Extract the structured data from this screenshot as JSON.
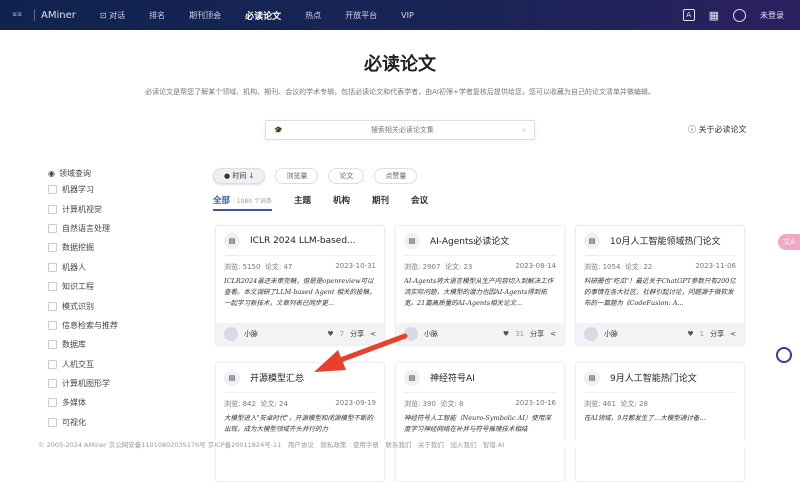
{
  "header": {
    "logo1": "AMiner logo",
    "logo2": "AMiner",
    "nav": [
      "对话",
      "排名",
      "期刊顶会",
      "必读论文",
      "热点",
      "开放平台",
      "VIP"
    ],
    "active": "必读论文",
    "login": "未登录"
  },
  "page": {
    "title": "必读论文",
    "description": "必读论文是帮您了解某个领域、机构、期刊、会议的学术专辑，包括必读论文和代表学者，由AI初筛+学者复核后提供给您，您可以收藏为自己的论文清单并做编辑。",
    "search_placeholder": "搜索相关必读论文集",
    "help": "关于必读论文"
  },
  "sidebar": {
    "heading": "领域查询",
    "items": [
      "机器学习",
      "计算机视觉",
      "自然语言处理",
      "数据挖掘",
      "机器人",
      "知识工程",
      "模式识别",
      "信息检索与推荐",
      "数据库",
      "人机交互",
      "计算机图形学",
      "多媒体",
      "可视化"
    ]
  },
  "sort": [
    "时间 ↓",
    "浏览量",
    "论文",
    "点赞量"
  ],
  "tabs": {
    "all": "全部",
    "count": "· 1080 个词条",
    "items": [
      "主题",
      "机构",
      "期刊",
      "会议"
    ]
  },
  "labels": {
    "views": "浏览:",
    "papers": "论文:",
    "share": "分享"
  },
  "cards": [
    {
      "title": "ICLR 2024 LLM-based...",
      "views": "5150",
      "papers": "47",
      "date": "2023-10-31",
      "desc": "ICLR2024虽还未审完稿，但是是openreview可以查看。本文调研了LLM-based Agent 相关的投稿，一起学习新技术，文章列表已同步更...",
      "author": "小脉",
      "likes": "7"
    },
    {
      "title": "AI-Agents必读论文",
      "views": "2907",
      "papers": "23",
      "date": "2023-08-14",
      "desc": "AI-Agents将大语言模型从生产内容切入到解决工作流实际问题，大模型的潜力也因AI-Agents得到拓宽。21篇高质量的AI-Agents相关论文...",
      "author": "小脉",
      "likes": "31"
    },
    {
      "title": "10月人工智能领域热门论文",
      "views": "1054",
      "papers": "22",
      "date": "2023-11-06",
      "desc": "科研圈也\"吃瓜\"！最近关于ChatGPT参数只有200亿的事情在各大社区、社群引起讨论，问题源于微软发布的一篇题为《CodeFusion: A...",
      "author": "小脉",
      "likes": "1"
    },
    {
      "title": "开源模型汇总",
      "views": "842",
      "papers": "24",
      "date": "2023-09-19",
      "desc": "大模型进入\"安卓时代\"，开源模型和闭源模型不断的出现，成为大模型领域齐头并行的力",
      "author": "",
      "likes": ""
    },
    {
      "title": "神经符号AI",
      "views": "390",
      "papers": "8",
      "date": "2023-10-16",
      "desc": "神经符号人工智能（Neuro-Symbolic AI）使用深度学习神经网络在补并与符号推理技术相结",
      "author": "",
      "likes": ""
    },
    {
      "title": "9月人工智能热门论文",
      "views": "461",
      "papers": "28",
      "date": "",
      "desc": "在AI领域，9月都发生了…大模型通讨备…",
      "author": "",
      "likes": ""
    }
  ],
  "footer": "© 2005-2024 AMiner 京公网安备11010802035176号 京ICP备20011824号-11　用户协议　隐私政策　使用手册　联系我们　关于我们　加入我们　智谱.AI",
  "colors": {
    "header": "#1a2457",
    "accent": "#3d5a9e",
    "annotation_arrow": "#e8402a"
  }
}
